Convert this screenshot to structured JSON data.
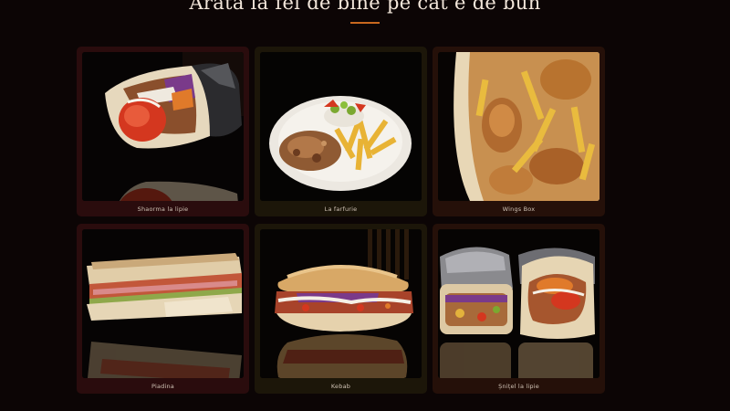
{
  "section": {
    "heading": "Arată la fel de bine pe cât e de bun",
    "accent_color": "#c8681e"
  },
  "menu": [
    {
      "name": "Shaorma la lipie",
      "image": "shawarma-wrap-photo"
    },
    {
      "name": "La farfurie",
      "image": "plate-photo"
    },
    {
      "name": "Wings Box",
      "image": "wings-box-photo"
    },
    {
      "name": "Piadina",
      "image": "piadina-photo"
    },
    {
      "name": "Kebab",
      "image": "kebab-photo"
    },
    {
      "name": "Șnițel la lipie",
      "image": "schnitzel-wrap-photo"
    }
  ]
}
